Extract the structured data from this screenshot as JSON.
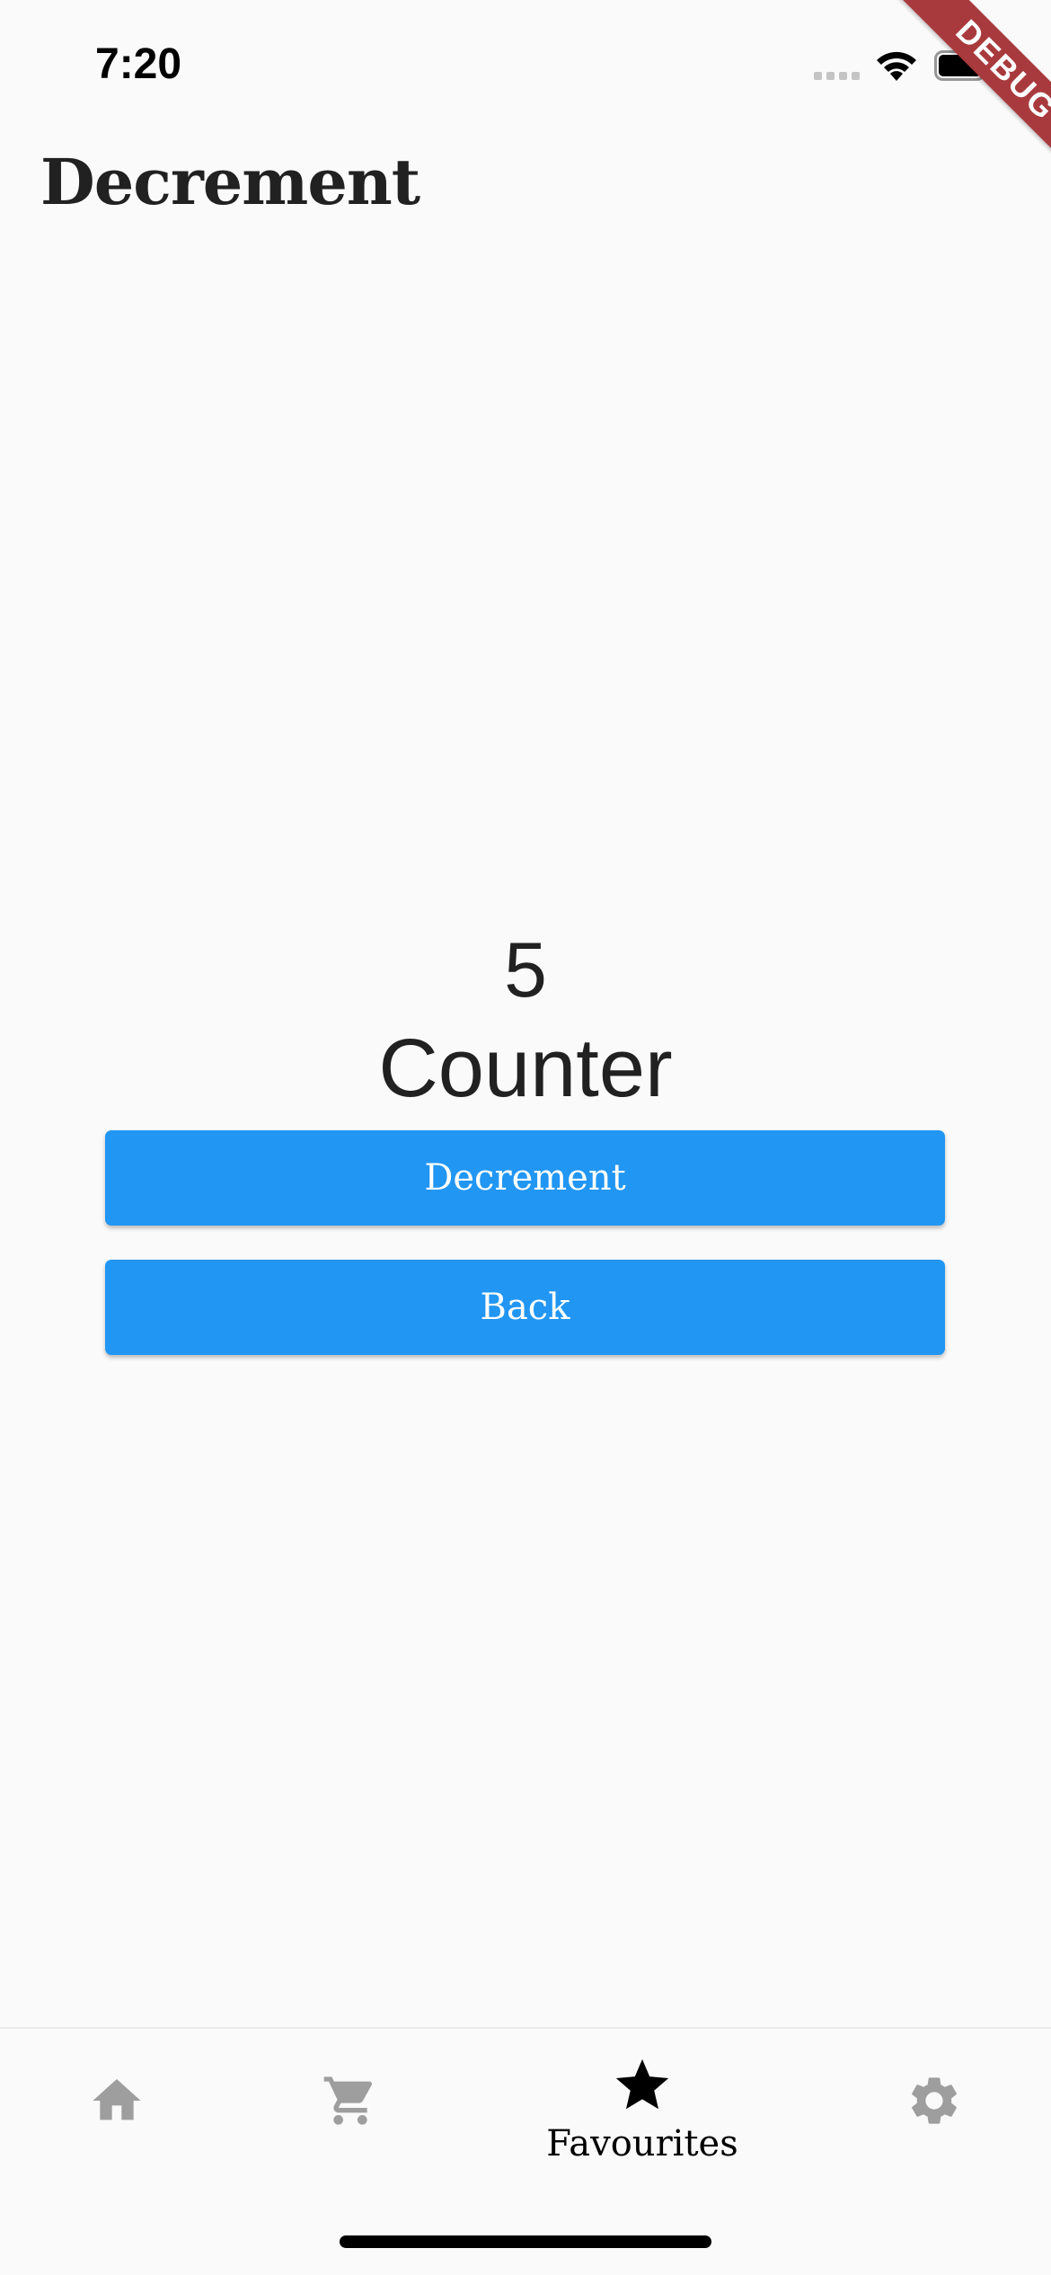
{
  "status_bar": {
    "time": "7:20"
  },
  "debug_banner": "DEBUG",
  "app_bar": {
    "title": "Decrement"
  },
  "counter": {
    "value": "5",
    "label": "Counter"
  },
  "buttons": {
    "decrement_label": "Decrement",
    "back_label": "Back"
  },
  "bottom_nav": {
    "items": [
      {
        "icon": "home-icon",
        "label": "",
        "selected": false
      },
      {
        "icon": "cart-icon",
        "label": "",
        "selected": false
      },
      {
        "icon": "star-icon",
        "label": "Favourites",
        "selected": true
      },
      {
        "icon": "gear-icon",
        "label": "",
        "selected": false
      }
    ]
  },
  "colors": {
    "background": "#fafafa",
    "primary_button": "#2196f3",
    "button_text": "#ffffff",
    "nav_inactive": "#9e9e9e",
    "nav_active": "#000000",
    "debug_banner": "#a83a3d"
  }
}
